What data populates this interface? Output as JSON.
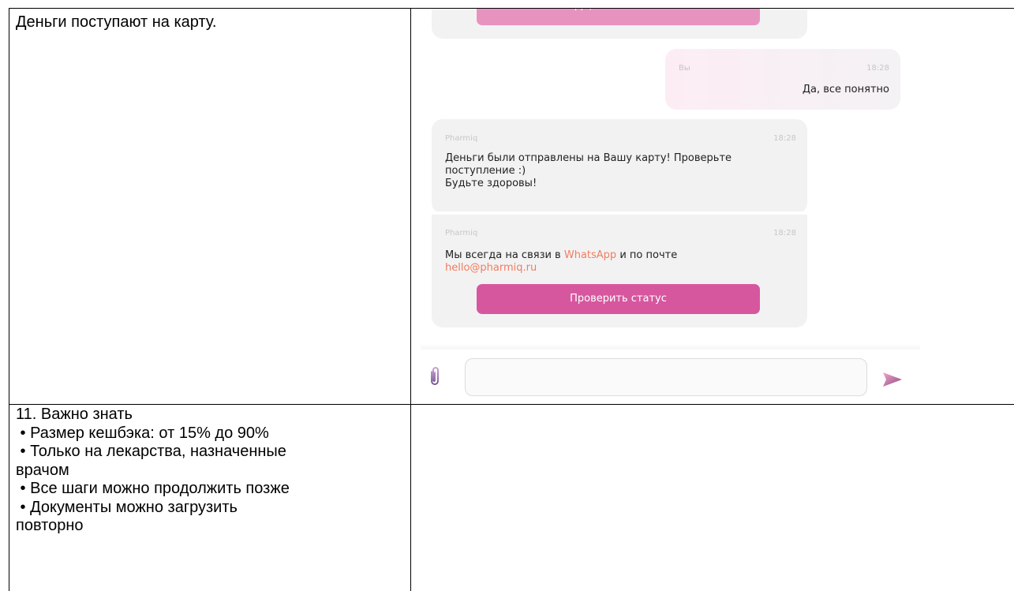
{
  "table": {
    "row1_left": "Деньги поступают на карту.",
    "row2_left": {
      "heading": "11. Важно знать",
      "lines": [
        " • Размер кешбэка: от 15% до 90%",
        " • Только на лекарства, назначенные",
        "врачом",
        " • Все шаги можно продолжить позже",
        " • Документы можно загрузить",
        "повторно"
      ]
    }
  },
  "chat": {
    "top_button_label": "Да, все понятно",
    "user_message": {
      "sender": "Вы",
      "time": "18:28",
      "text": "Да, все понятно"
    },
    "bot_message_1": {
      "sender": "Pharmiq",
      "time": "18:28",
      "lines": [
        "Деньги были отправлены на Вашу карту! Проверьте",
        "поступление :)",
        "Будьте здоровы!"
      ]
    },
    "bot_message_2": {
      "sender": "Pharmiq",
      "time": "18:28",
      "text_before_link": "Мы всегда на связи в ",
      "whatsapp_link": "WhatsApp",
      "text_after_link": " и по почте",
      "email_link": "hello@pharmiq.ru",
      "button_label": "Проверить статус"
    },
    "input": {
      "value": "",
      "placeholder": ""
    },
    "icons": {
      "attach": "paperclip-icon",
      "send": "send-icon"
    },
    "colors": {
      "button_pink": "#d7579f",
      "button_faded_pink": "#e793c0",
      "link_orange": "#f17d5f",
      "send_icon_gradient_start": "#f3a6c6",
      "send_icon_gradient_end": "#8c4a8a"
    }
  }
}
